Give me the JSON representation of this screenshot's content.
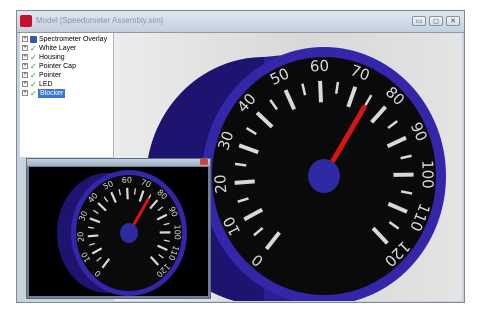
{
  "window": {
    "title": "Model [Speedometer Assembly.sim]",
    "buttons": [
      "minimize",
      "maximize",
      "close"
    ]
  },
  "tree": {
    "items": [
      {
        "label": "Spectrometer Overlay",
        "icon": "assembly-icon",
        "selected": false
      },
      {
        "label": "White Layer",
        "icon": "check-icon",
        "selected": false
      },
      {
        "label": "Housing",
        "icon": "check-icon",
        "selected": false
      },
      {
        "label": "Pointer Cap",
        "icon": "check-icon",
        "selected": false
      },
      {
        "label": "Pointer",
        "icon": "check-icon",
        "selected": false
      },
      {
        "label": "LED",
        "icon": "check-icon",
        "selected": false
      },
      {
        "label": "Blocker",
        "icon": "check-icon",
        "selected": true
      }
    ]
  },
  "gauge": {
    "ticks": [
      "0",
      "10",
      "20",
      "30",
      "40",
      "50",
      "60",
      "70",
      "80",
      "90",
      "100",
      "110",
      "120"
    ],
    "needle_value": 75,
    "scale_max": 120,
    "colors": {
      "housing": "#2b1f8f",
      "face": "#0a0a0a",
      "ticks": "#d9d9d9",
      "needle": "#d81414",
      "hub": "#2d2aa3"
    }
  },
  "preview": {
    "ticks": [
      "0",
      "10",
      "20",
      "30",
      "40",
      "50",
      "60",
      "70",
      "80",
      "90",
      "100",
      "110",
      "120"
    ]
  }
}
